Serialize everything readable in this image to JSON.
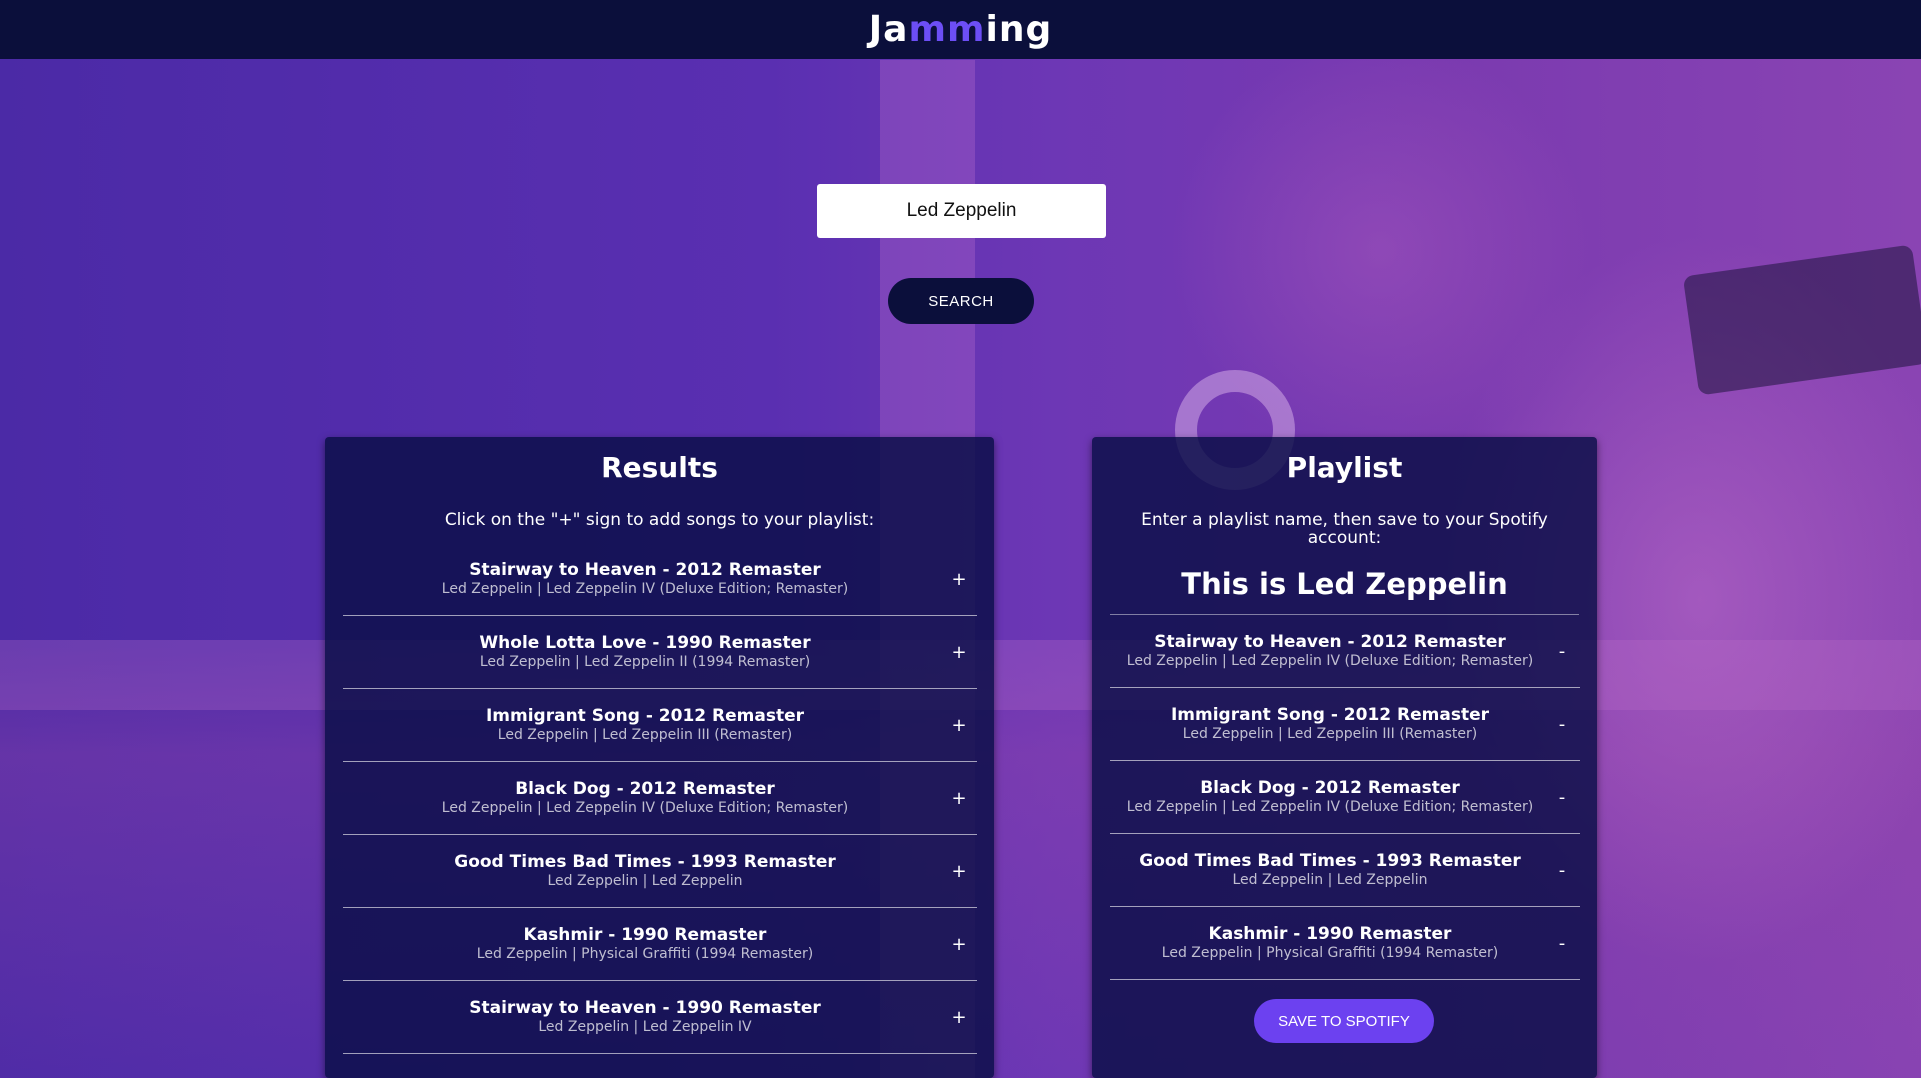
{
  "header": {
    "logo": [
      {
        "text": "Ja",
        "style": "w"
      },
      {
        "text": "mm",
        "style": "a"
      },
      {
        "text": "ing",
        "style": "w"
      }
    ]
  },
  "search": {
    "value": "Led Zeppelin",
    "button_label": "SEARCH"
  },
  "results": {
    "title": "Results",
    "hint": "Click on the \"+\" sign to add songs to your playlist:",
    "action_symbol": "+",
    "tracks": [
      {
        "title": "Stairway to Heaven - 2012 Remaster",
        "meta": "Led Zeppelin | Led Zeppelin IV (Deluxe Edition; Remaster)"
      },
      {
        "title": "Whole Lotta Love - 1990 Remaster",
        "meta": "Led Zeppelin | Led Zeppelin II (1994 Remaster)"
      },
      {
        "title": "Immigrant Song - 2012 Remaster",
        "meta": "Led Zeppelin | Led Zeppelin III (Remaster)"
      },
      {
        "title": "Black Dog - 2012 Remaster",
        "meta": "Led Zeppelin | Led Zeppelin IV (Deluxe Edition; Remaster)"
      },
      {
        "title": "Good Times Bad Times - 1993 Remaster",
        "meta": "Led Zeppelin | Led Zeppelin"
      },
      {
        "title": "Kashmir - 1990 Remaster",
        "meta": "Led Zeppelin | Physical Graffiti (1994 Remaster)"
      },
      {
        "title": "Stairway to Heaven - 1990 Remaster",
        "meta": "Led Zeppelin | Led Zeppelin IV"
      }
    ]
  },
  "playlist": {
    "title": "Playlist",
    "hint": "Enter a playlist name, then save to your Spotify account:",
    "name": "This is Led Zeppelin",
    "action_symbol": "-",
    "tracks": [
      {
        "title": "Stairway to Heaven - 2012 Remaster",
        "meta": "Led Zeppelin | Led Zeppelin IV (Deluxe Edition; Remaster)"
      },
      {
        "title": "Immigrant Song - 2012 Remaster",
        "meta": "Led Zeppelin | Led Zeppelin III (Remaster)"
      },
      {
        "title": "Black Dog - 2012 Remaster",
        "meta": "Led Zeppelin | Led Zeppelin IV (Deluxe Edition; Remaster)"
      },
      {
        "title": "Good Times Bad Times - 1993 Remaster",
        "meta": "Led Zeppelin | Led Zeppelin"
      },
      {
        "title": "Kashmir - 1990 Remaster",
        "meta": "Led Zeppelin | Physical Graffiti (1994 Remaster)"
      }
    ],
    "save_label": "SAVE TO SPOTIFY"
  },
  "colors": {
    "header_bg": "#0b0f3b",
    "accent": "#6c4ef5",
    "panel_bg": "#080e46",
    "save_button": "#6c41f0"
  }
}
